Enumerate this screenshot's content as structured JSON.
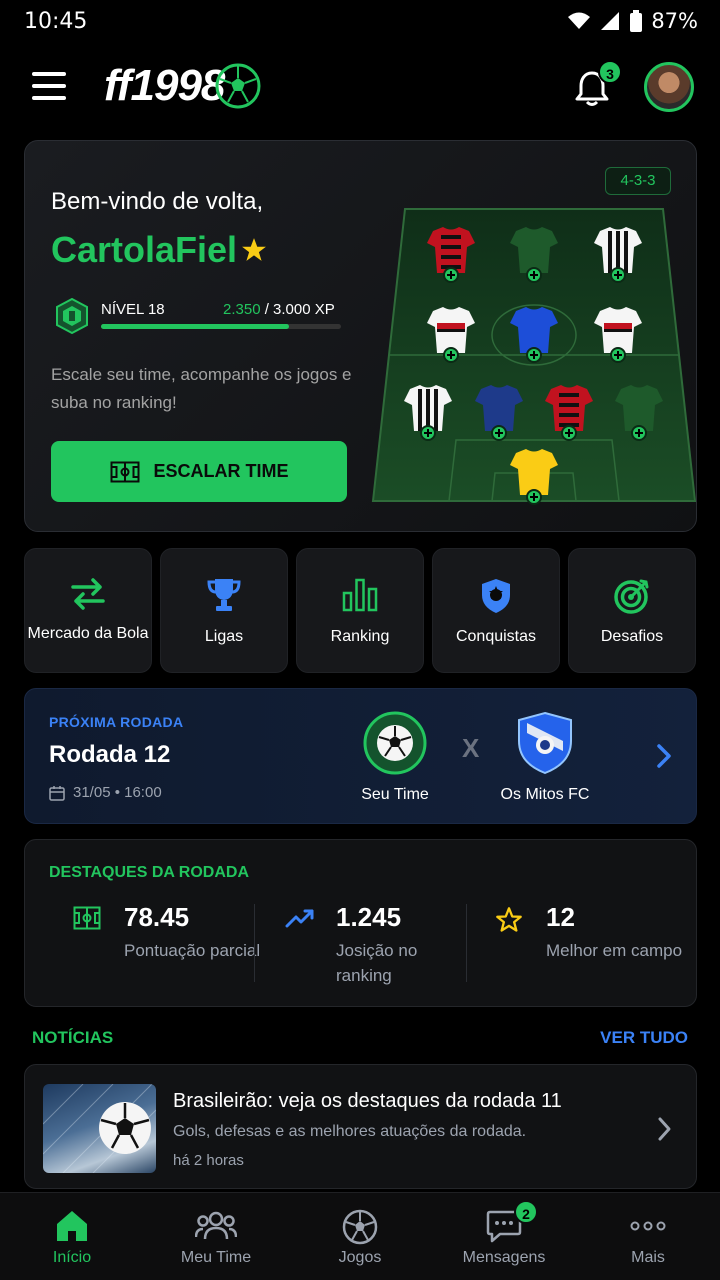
{
  "status_bar": {
    "time": "10:45",
    "battery": "87%"
  },
  "header": {
    "logo": "ff1998",
    "notification_count": "3"
  },
  "hero": {
    "welcome": "Bem-vindo de volta,",
    "username": "CartolaFiel",
    "level": "NÍVEL 18",
    "xp_current": "2.350",
    "xp_total": " / 3.000 XP",
    "xp_progress": 0.783,
    "description": "Escale seu time, acompanhe os jogos e suba no ranking!",
    "cta": "ESCALAR TIME",
    "formation": "4-3-3"
  },
  "actions": [
    {
      "label": "Mercado da Bola",
      "icon": "transfer-icon"
    },
    {
      "label": "Ligas",
      "icon": "trophy-icon"
    },
    {
      "label": "Ranking",
      "icon": "bar-chart-icon"
    },
    {
      "label": "Conquistas",
      "icon": "shield-badge-icon"
    },
    {
      "label": "Desafios",
      "icon": "target-icon"
    }
  ],
  "next_round": {
    "kicker": "PRÓXIMA RODADA",
    "title": "Rodada 12",
    "date": "31/05 • 16:00",
    "team1": "Seu Time",
    "vs": "X",
    "team2": "Os Mitos FC"
  },
  "highlights": {
    "kicker": "DESTAQUES DA RODADA",
    "stats": [
      {
        "value": "78.45",
        "caption": "Pontuação parcial",
        "icon": "field-icon"
      },
      {
        "value": "1.245",
        "caption": "Josição no ranking",
        "icon": "trend-up-icon"
      },
      {
        "value": "12",
        "caption": "Melhor em campo",
        "icon": "star-icon"
      }
    ]
  },
  "news": {
    "heading": "NOTÍCIAS",
    "see_all": "VER TUDO",
    "item": {
      "title": "Brasileirão: veja os destaques da rodada 11",
      "description": "Gols, defesas e as melhores atuações da rodada.",
      "time": "há 2 horas"
    }
  },
  "bottom_nav": [
    {
      "label": "Início",
      "icon": "home-icon",
      "active": true
    },
    {
      "label": "Meu Time",
      "icon": "users-icon"
    },
    {
      "label": "Jogos",
      "icon": "soccer-ball-icon"
    },
    {
      "label": "Mensagens",
      "icon": "chat-icon",
      "badge": "2"
    },
    {
      "label": "Mais",
      "icon": "more-icon"
    }
  ],
  "colors": {
    "accent": "#22c55e",
    "blue": "#3b82f6",
    "background": "#000000"
  }
}
